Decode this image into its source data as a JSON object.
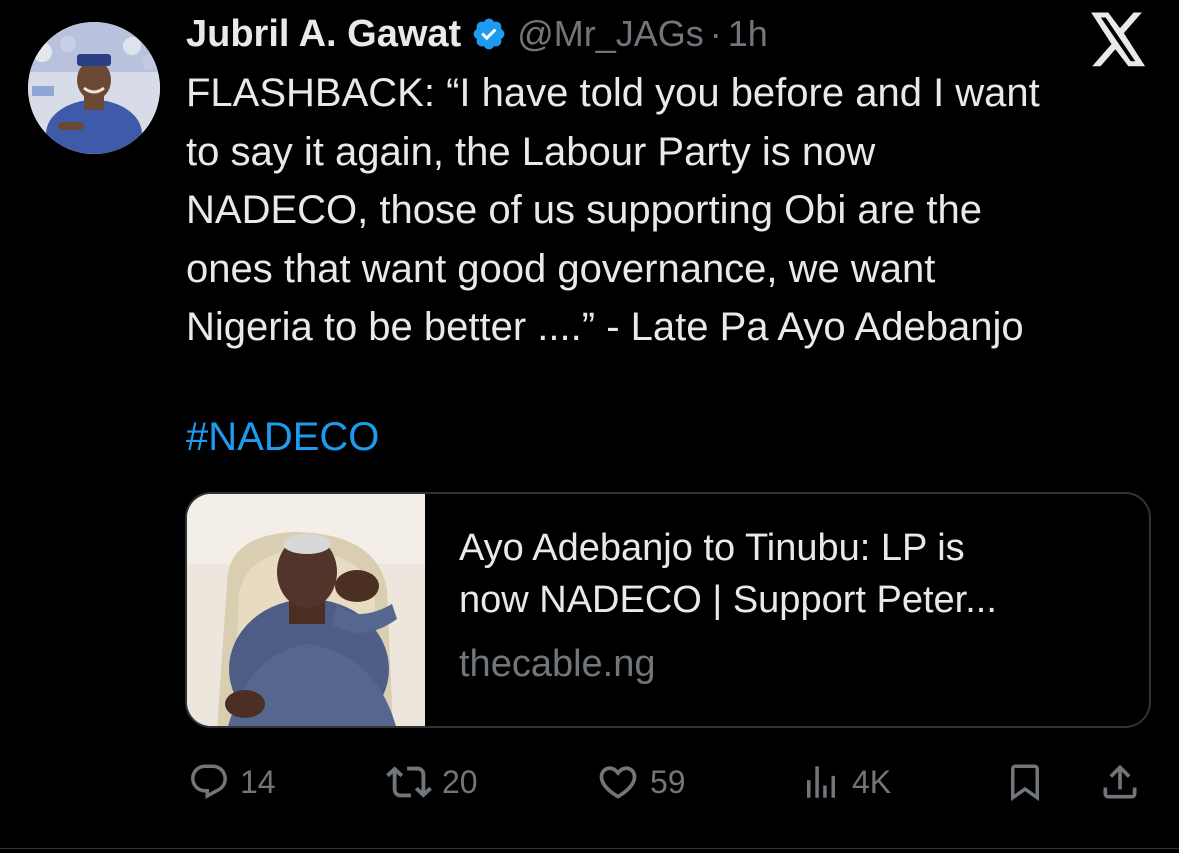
{
  "author": {
    "display_name": "Jubril A. Gawat",
    "handle": "@Mr_JAGs",
    "separator": "·",
    "time": "1h",
    "verified": true
  },
  "tweet": {
    "lines": [
      "FLASHBACK: “I have told you before and I want",
      "to say it again, the Labour Party is now",
      "NADECO, those of us supporting Obi are the",
      "ones that want good governance, we want",
      "Nigeria to be better ....” - Late Pa Ayo Adebanjo"
    ],
    "hashtag": "#NADECO"
  },
  "link_card": {
    "title_lines": [
      "Ayo Adebanjo to Tinubu: LP is",
      "now NADECO | Support Peter..."
    ],
    "domain": "thecable.ng"
  },
  "actions": {
    "reply_count": "14",
    "repost_count": "20",
    "like_count": "59",
    "view_count": "4K"
  },
  "icons": {
    "reply": "reply-icon",
    "repost": "repost-icon",
    "like": "heart-icon",
    "views": "analytics-icon",
    "bookmark": "bookmark-icon",
    "share": "share-icon",
    "verified": "verified-badge-icon",
    "brand": "x-logo-icon"
  },
  "colors": {
    "background": "#000000",
    "text": "#e7e9ea",
    "muted": "#71767b",
    "accent": "#1d9bf0",
    "border": "#2f3336"
  }
}
